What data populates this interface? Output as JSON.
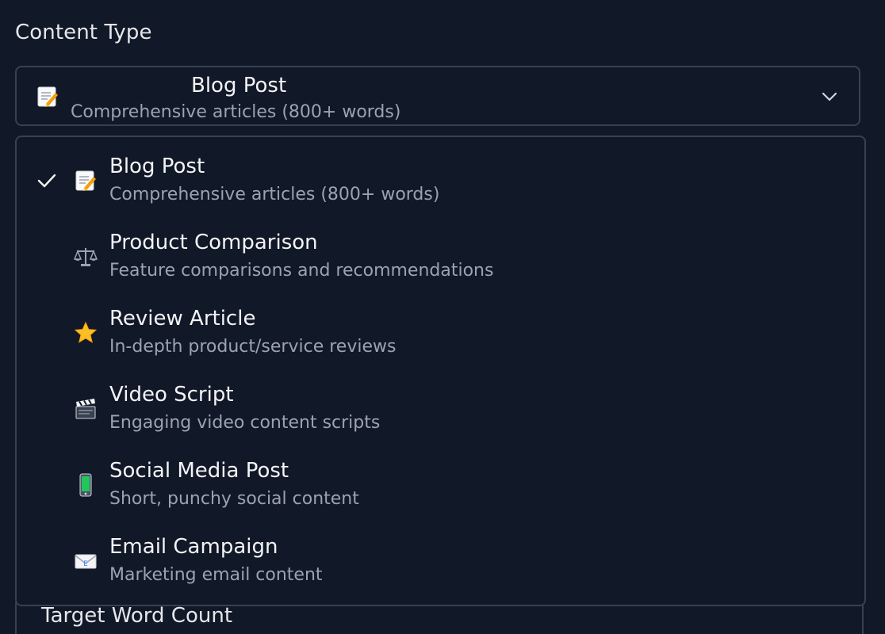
{
  "field": {
    "label": "Content Type",
    "next_label": "Target Word Count"
  },
  "select": {
    "selected_title": "Blog Post",
    "selected_desc": "Comprehensive articles (800+ words)",
    "selected_icon": "memo-icon"
  },
  "options": [
    {
      "title": "Blog Post",
      "desc": "Comprehensive articles (800+ words)",
      "icon": "memo-icon",
      "selected": true
    },
    {
      "title": "Product Comparison",
      "desc": "Feature comparisons and recommendations",
      "icon": "balance-scale-icon",
      "selected": false
    },
    {
      "title": "Review Article",
      "desc": "In-depth product/service reviews",
      "icon": "star-icon",
      "selected": false
    },
    {
      "title": "Video Script",
      "desc": "Engaging video content scripts",
      "icon": "clapperboard-icon",
      "selected": false
    },
    {
      "title": "Social Media Post",
      "desc": "Short, punchy social content",
      "icon": "mobile-phone-icon",
      "selected": false
    },
    {
      "title": "Email Campaign",
      "desc": "Marketing email content",
      "icon": "envelope-icon",
      "selected": false
    }
  ],
  "colors": {
    "background": "#111827",
    "border": "#374151",
    "text": "#f3f4f6",
    "muted_text": "#9ca3af"
  }
}
